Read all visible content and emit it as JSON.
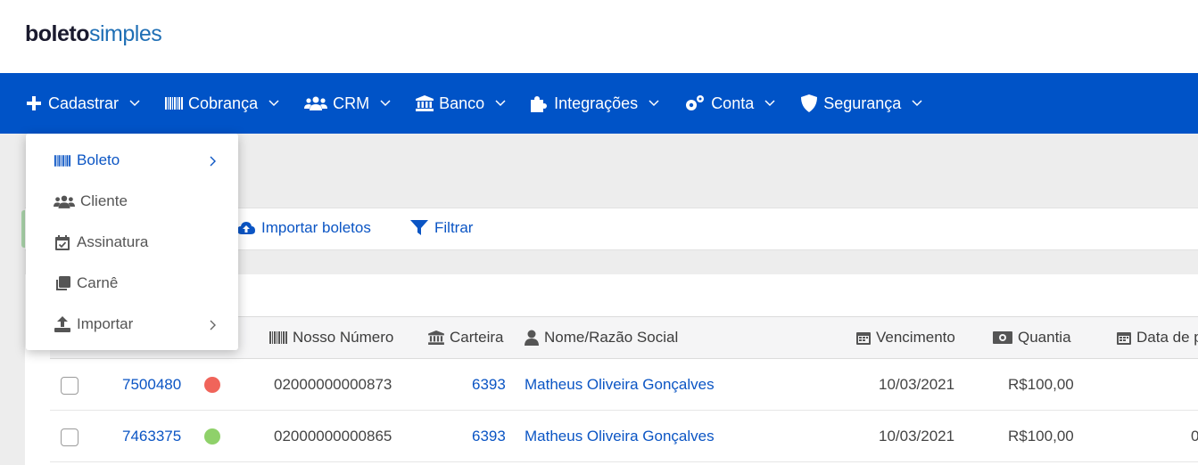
{
  "logo": {
    "part1": "boleto",
    "part2": "simples"
  },
  "nav": {
    "items": [
      {
        "label": "Cadastrar",
        "icon": "plus-icon"
      },
      {
        "label": "Cobrança",
        "icon": "barcode-icon"
      },
      {
        "label": "CRM",
        "icon": "users-icon"
      },
      {
        "label": "Banco",
        "icon": "bank-icon"
      },
      {
        "label": "Integrações",
        "icon": "puzzle-icon"
      },
      {
        "label": "Conta",
        "icon": "gears-icon"
      },
      {
        "label": "Segurança",
        "icon": "shield-icon"
      }
    ]
  },
  "dropdown": {
    "items": [
      {
        "label": "Boleto",
        "icon": "barcode-icon",
        "active": true,
        "submenu": true
      },
      {
        "label": "Cliente",
        "icon": "users-icon",
        "active": false,
        "submenu": false
      },
      {
        "label": "Assinatura",
        "icon": "calendar-check-icon",
        "active": false,
        "submenu": false
      },
      {
        "label": "Carnê",
        "icon": "clone-icon",
        "active": false,
        "submenu": false
      },
      {
        "label": "Importar",
        "icon": "upload-icon",
        "active": false,
        "submenu": true
      }
    ]
  },
  "toolbar": {
    "import_label": "Importar boletos",
    "filter_label": "Filtrar"
  },
  "table": {
    "headers": {
      "nosso_numero": "Nosso Número",
      "carteira": "Carteira",
      "nome": "Nome/Razão Social",
      "vencimento": "Vencimento",
      "quantia": "Quantia",
      "data_pagamento": "Data de p"
    },
    "rows": [
      {
        "id": "7500480",
        "status_color": "#f0645a",
        "nosso_numero": "02000000000873",
        "carteira": "6393",
        "nome": "Matheus Oliveira Gonçalves",
        "vencimento": "10/03/2021",
        "quantia": "R$100,00",
        "data_pagamento": ""
      },
      {
        "id": "7463375",
        "status_color": "#8fd16a",
        "nosso_numero": "02000000000865",
        "carteira": "6393",
        "nome": "Matheus Oliveira Gonçalves",
        "vencimento": "10/03/2021",
        "quantia": "R$100,00",
        "data_pagamento": "0"
      }
    ]
  },
  "colors": {
    "nav_bg": "#0053c7",
    "link": "#0b55c4",
    "brand_dark": "#1a1a2e",
    "brand_light": "#1f6fb5"
  }
}
